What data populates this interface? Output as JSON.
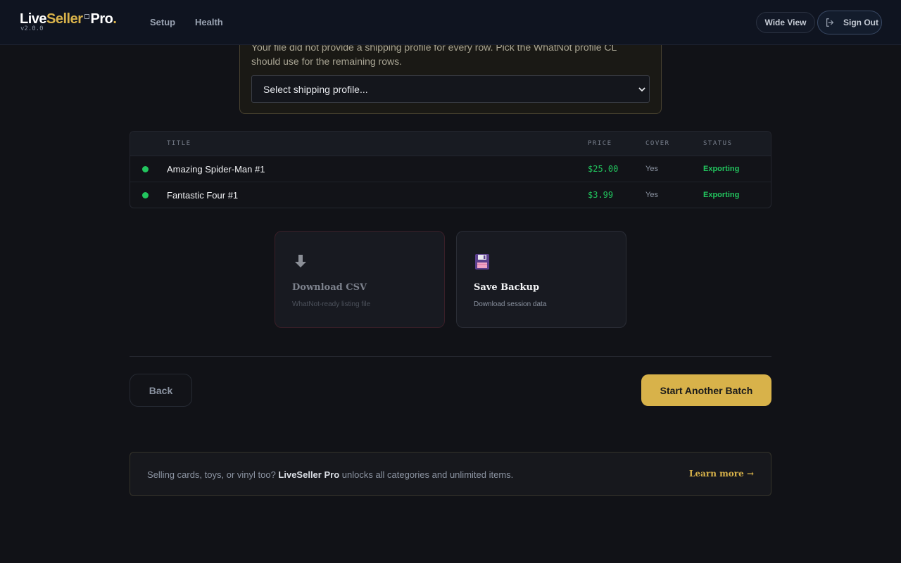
{
  "header": {
    "logo": {
      "live": "Live",
      "seller": "Seller",
      "pro": "Pro",
      "dot": ".",
      "version": "v2.0.0"
    },
    "nav": [
      {
        "label": "Setup"
      },
      {
        "label": "Health"
      }
    ],
    "wide_view_label": "Wide View",
    "sign_out_label": "Sign Out"
  },
  "shipping": {
    "message": "Your file did not provide a shipping profile for every row. Pick the WhatNot profile CL should use for the remaining rows.",
    "select_value": "Select shipping profile..."
  },
  "table": {
    "headers": [
      "TITLE",
      "PRICE",
      "COVER",
      "STATUS"
    ],
    "rows": [
      {
        "title": "Amazing Spider-Man #1",
        "price": "$25.00",
        "cover": "Yes",
        "status": "Exporting"
      },
      {
        "title": "Fantastic Four #1",
        "price": "$3.99",
        "cover": "Yes",
        "status": "Exporting"
      }
    ]
  },
  "actions": {
    "download_csv": {
      "title": "Download CSV",
      "subtitle": "WhatNot-ready listing file",
      "icon": "download-arrow-icon"
    },
    "save_backup": {
      "title": "Save Backup",
      "subtitle": "Download session data",
      "icon": "floppy-disk-icon"
    }
  },
  "footer_nav": {
    "back_label": "Back",
    "start_label": "Start Another Batch"
  },
  "promo": {
    "text_before": "Selling cards, toys, or vinyl too? ",
    "brand": "LiveSeller Pro",
    "text_after": " unlocks all categories and unlimited items.",
    "link_label": "Learn more →"
  },
  "colors": {
    "accent": "#d8b24a",
    "success": "#22c55e",
    "background": "#111217"
  }
}
